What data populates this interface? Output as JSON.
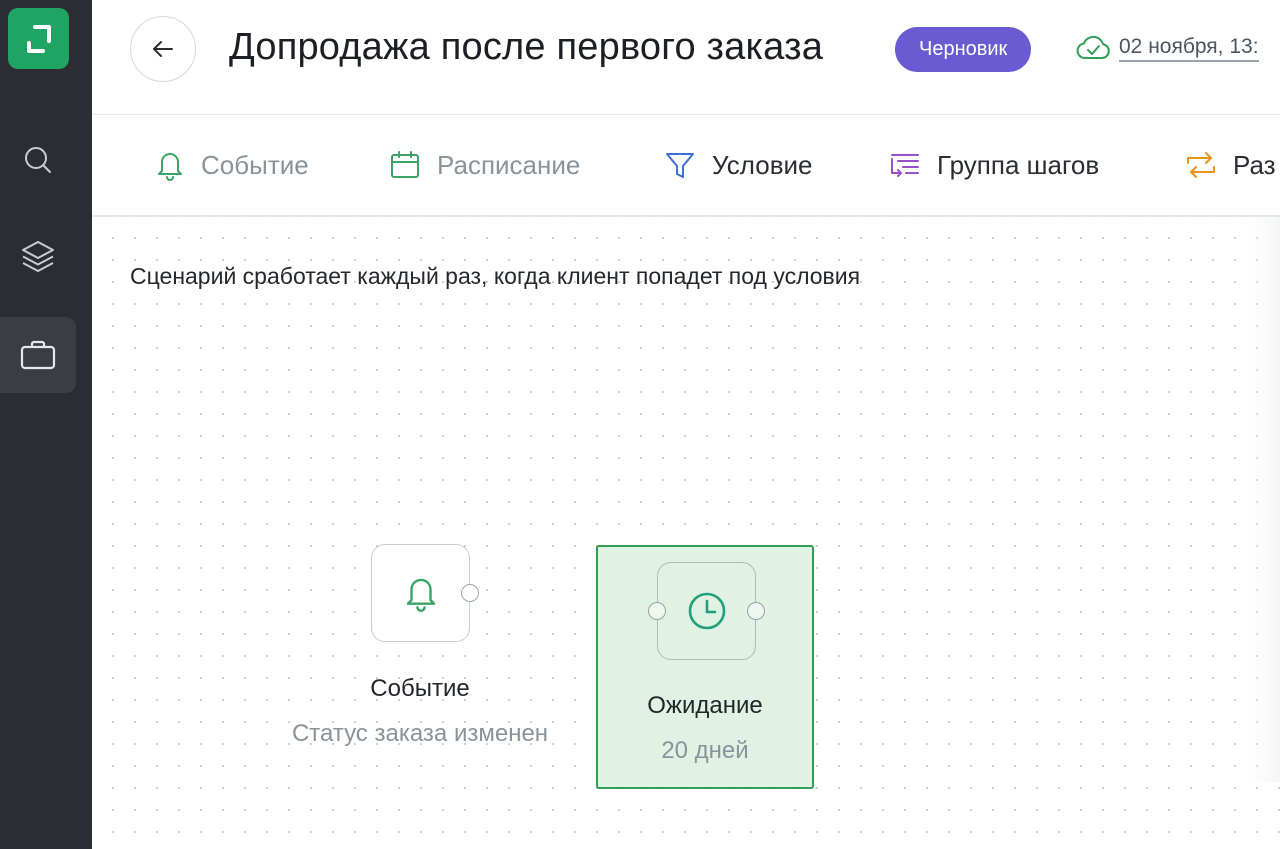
{
  "header": {
    "title": "Допродажа после первого заказа",
    "status_badge": "Черновик",
    "saved_at": "02 ноября, 13:"
  },
  "toolbar": {
    "items": [
      {
        "label": "Событие",
        "icon": "bell-icon",
        "color": "#3aa365"
      },
      {
        "label": "Расписание",
        "icon": "calendar-icon",
        "color": "#3aa365"
      },
      {
        "label": "Условие",
        "icon": "filter-icon",
        "color": "#3b6fd6"
      },
      {
        "label": "Группа шагов",
        "icon": "step-group-icon",
        "color": "#9b4fc8"
      },
      {
        "label": "Раз",
        "icon": "split-icon",
        "color": "#e8921e"
      }
    ]
  },
  "canvas": {
    "hint": "Сценарий сработает каждый раз, когда клиент попадет под условия",
    "nodes": [
      {
        "title": "Событие",
        "subtitle": "Статус заказа изменен",
        "icon": "bell-icon"
      },
      {
        "title": "Ожидание",
        "subtitle": "20 дней",
        "icon": "clock-icon",
        "selected": true
      }
    ]
  },
  "sidebar": {
    "items": [
      "search-icon",
      "layers-icon",
      "briefcase-icon"
    ]
  },
  "colors": {
    "accent_green": "#1fa463",
    "badge_purple": "#6b5bd3",
    "sidebar_bg": "#2b2d33",
    "selected_node_bg": "#dff2e4"
  }
}
